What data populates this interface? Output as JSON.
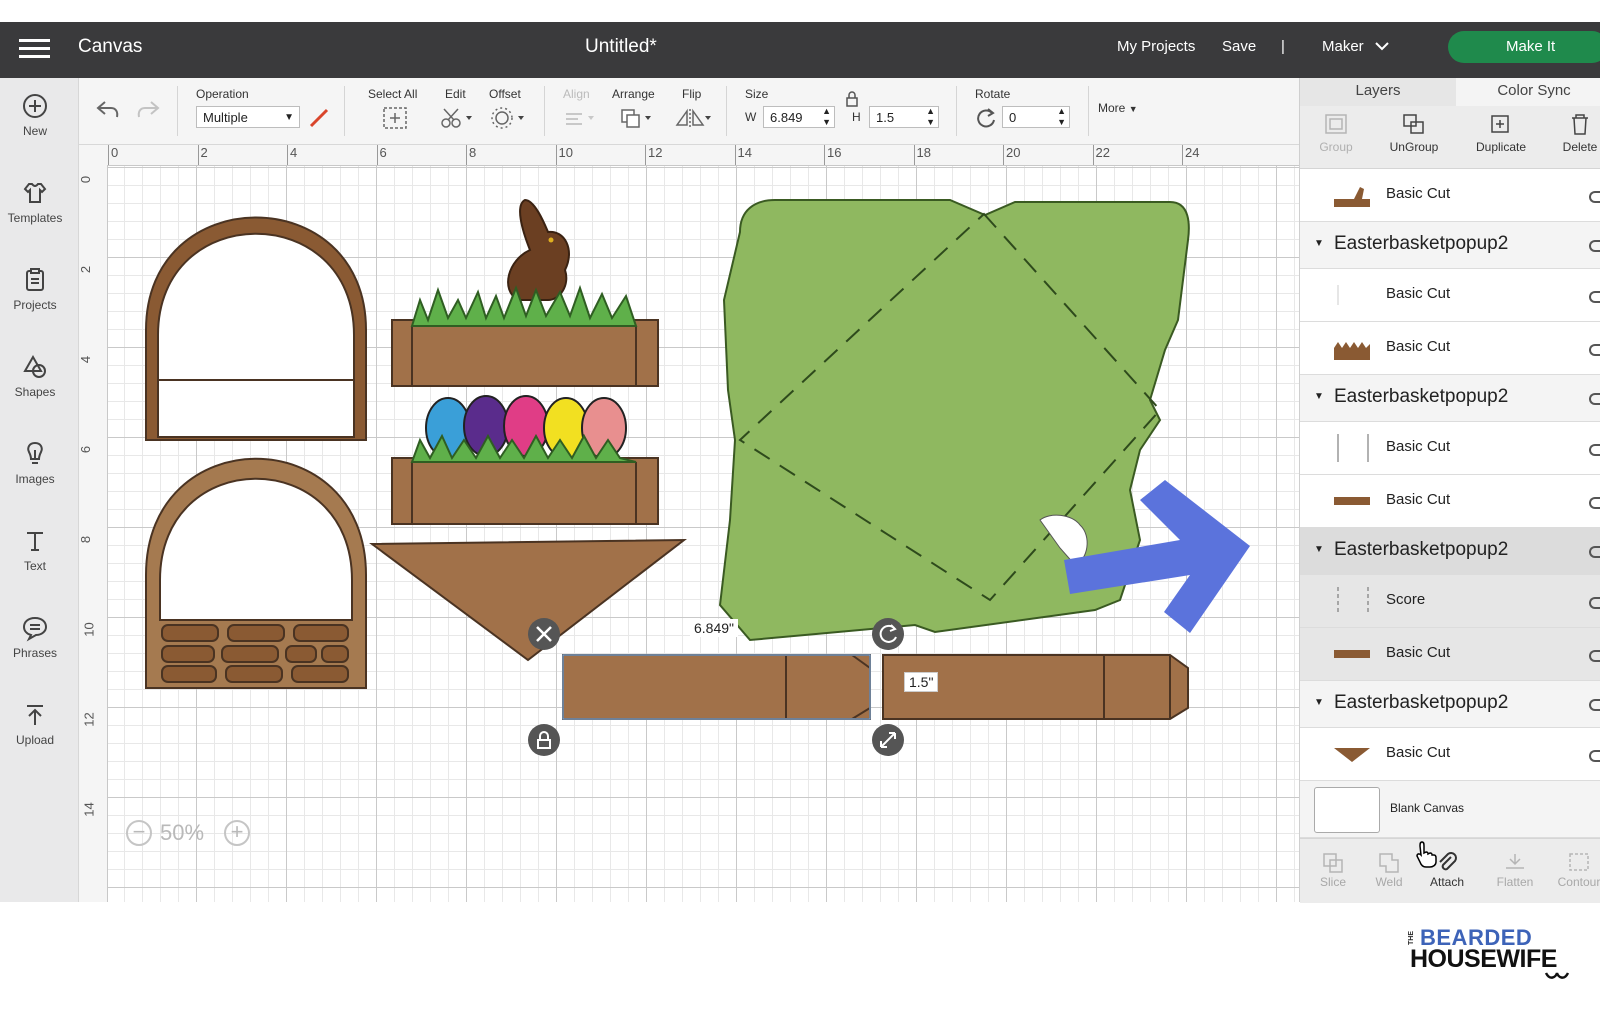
{
  "header": {
    "menu_icon": "hamburger-icon",
    "app_title": "Canvas",
    "doc_title": "Untitled*",
    "my_projects": "My Projects",
    "save": "Save",
    "separator": "|",
    "machine": "Maker",
    "make_it": "Make It",
    "accent_color": "#1f8a4c"
  },
  "sidebar": {
    "items": [
      {
        "label": "New",
        "icon": "plus-circle-icon"
      },
      {
        "label": "Templates",
        "icon": "shirt-icon"
      },
      {
        "label": "Projects",
        "icon": "clipboard-icon"
      },
      {
        "label": "Shapes",
        "icon": "shapes-icon"
      },
      {
        "label": "Images",
        "icon": "lightbulb-icon"
      },
      {
        "label": "Text",
        "icon": "text-icon"
      },
      {
        "label": "Phrases",
        "icon": "speech-bubble-icon"
      },
      {
        "label": "Upload",
        "icon": "upload-icon"
      }
    ]
  },
  "toolbar": {
    "operation_label": "Operation",
    "operation_value": "Multiple",
    "select_all": "Select All",
    "edit": "Edit",
    "offset": "Offset",
    "align": "Align",
    "arrange": "Arrange",
    "flip": "Flip",
    "size": "Size",
    "w_label": "W",
    "w_value": "6.849",
    "h_label": "H",
    "h_value": "1.5",
    "rotate": "Rotate",
    "rotate_value": "0",
    "more": "More"
  },
  "ruler": {
    "top": [
      "0",
      "2",
      "4",
      "6",
      "8",
      "10",
      "12",
      "14",
      "16",
      "18",
      "20",
      "22",
      "24"
    ],
    "left": [
      "0",
      "2",
      "4",
      "6",
      "8",
      "10",
      "12",
      "14"
    ]
  },
  "canvas": {
    "width_readout": "6.849\"",
    "height_readout": "1.5\"",
    "zoom": "50%",
    "colors": {
      "brown": "#a17149",
      "grass": "#8fb860",
      "arrow": "#5b73dc"
    }
  },
  "layers": {
    "tabs": [
      "Layers",
      "Color Sync"
    ],
    "actions": [
      "Group",
      "UnGroup",
      "Duplicate",
      "Delete"
    ],
    "rows": [
      {
        "kind": "layer",
        "name": "Basic Cut"
      },
      {
        "kind": "group",
        "name": "Easterbasketpopup2"
      },
      {
        "kind": "layer",
        "name": "Basic Cut"
      },
      {
        "kind": "layer",
        "name": "Basic Cut"
      },
      {
        "kind": "group",
        "name": "Easterbasketpopup2"
      },
      {
        "kind": "layer",
        "name": "Basic Cut"
      },
      {
        "kind": "layer",
        "name": "Basic Cut"
      },
      {
        "kind": "group",
        "name": "Easterbasketpopup2"
      },
      {
        "kind": "layer",
        "name": "Score"
      },
      {
        "kind": "layer",
        "name": "Basic Cut"
      },
      {
        "kind": "group",
        "name": "Easterbasketpopup2"
      },
      {
        "kind": "layer",
        "name": "Basic Cut"
      }
    ],
    "blank_canvas": "Blank Canvas",
    "bottom_tools": [
      "Slice",
      "Weld",
      "Attach",
      "Flatten",
      "Contour"
    ]
  },
  "logo": {
    "line1": "BEARDED",
    "line2": "HOUSEWIFE",
    "prefix": "THE"
  }
}
